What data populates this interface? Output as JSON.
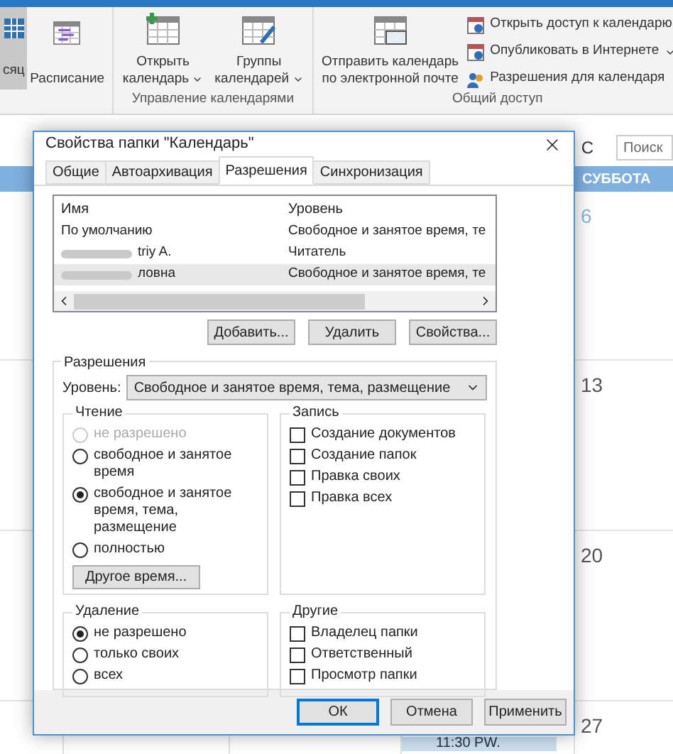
{
  "ribbon": {
    "view_buttons": [
      {
        "label": "сяц",
        "selected": true
      },
      {
        "label": "Расписание",
        "selected": false
      }
    ],
    "groups": [
      {
        "label": "Управление календарями",
        "buttons": [
          {
            "lines": [
              "Открыть",
              "календарь"
            ],
            "dropdown": true
          },
          {
            "lines": [
              "Группы",
              "календарей"
            ],
            "dropdown": true
          }
        ]
      },
      {
        "label": "Общий доступ",
        "buttons": [
          {
            "lines": [
              "Отправить календарь",
              "по электронной почте"
            ],
            "dropdown": false
          }
        ],
        "small_buttons": [
          {
            "label": "Открыть доступ к календарю",
            "dropdown": false
          },
          {
            "label": "Опубликовать в Интернете",
            "dropdown": true
          },
          {
            "label": "Разрешения для календаря",
            "dropdown": false
          }
        ]
      }
    ]
  },
  "calendar": {
    "header_letter": "С",
    "search": {
      "placeholder": "Поиск"
    },
    "day_header": "СУББОТА",
    "dates": [
      "6",
      "13",
      "20",
      "27"
    ],
    "event": "11:30 PW."
  },
  "dialog": {
    "title": "Свойства папки \"Календарь\"",
    "tabs": [
      {
        "label": "Общие",
        "selected": false
      },
      {
        "label": "Автоархивация",
        "selected": false
      },
      {
        "label": "Разрешения",
        "selected": true
      },
      {
        "label": "Синхронизация",
        "selected": false
      }
    ],
    "list": {
      "columns": [
        "Имя",
        "Уровень"
      ],
      "rows": [
        {
          "name": "По умолчанию",
          "level": "Свободное и занятое время, те",
          "selected": false,
          "redacted": false
        },
        {
          "name": "triy A.",
          "level": "Читатель",
          "selected": false,
          "redacted": true
        },
        {
          "name": "ловна",
          "level": "Свободное и занятое время, те",
          "selected": true,
          "redacted": true
        }
      ]
    },
    "list_buttons": [
      "Добавить...",
      "Удалить",
      "Свойства..."
    ],
    "permissions": {
      "title": "Разрешения",
      "level_label": "Уровень:",
      "level_value": "Свободное и занятое время, тема, размещение",
      "groups": [
        {
          "title": "Чтение",
          "kind": "radio",
          "options": [
            {
              "label": "не разрешено",
              "selected": false,
              "disabled": true
            },
            {
              "label": "свободное и занятое время",
              "selected": false,
              "disabled": false
            },
            {
              "label": "свободное и занятое время, тема, размещение",
              "selected": true,
              "disabled": false
            },
            {
              "label": "полностью",
              "selected": false,
              "disabled": false
            }
          ],
          "button": "Другое время..."
        },
        {
          "title": "Запись",
          "kind": "checkbox",
          "options": [
            {
              "label": "Создание документов",
              "checked": false
            },
            {
              "label": "Создание папок",
              "checked": false
            },
            {
              "label": "Правка своих",
              "checked": false
            },
            {
              "label": "Правка всех",
              "checked": false
            }
          ]
        },
        {
          "title": "Удаление",
          "kind": "radio",
          "options": [
            {
              "label": "не разрешено",
              "selected": true,
              "disabled": false
            },
            {
              "label": "только своих",
              "selected": false,
              "disabled": false
            },
            {
              "label": "всех",
              "selected": false,
              "disabled": false
            }
          ]
        },
        {
          "title": "Другие",
          "kind": "checkbox",
          "options": [
            {
              "label": "Владелец папки",
              "checked": false
            },
            {
              "label": "Ответственный",
              "checked": false
            },
            {
              "label": "Просмотр папки",
              "checked": false
            }
          ]
        }
      ]
    },
    "footer_buttons": [
      {
        "label": "ОК",
        "default": true
      },
      {
        "label": "Отмена",
        "default": false
      },
      {
        "label": "Применить",
        "default": false
      }
    ]
  }
}
